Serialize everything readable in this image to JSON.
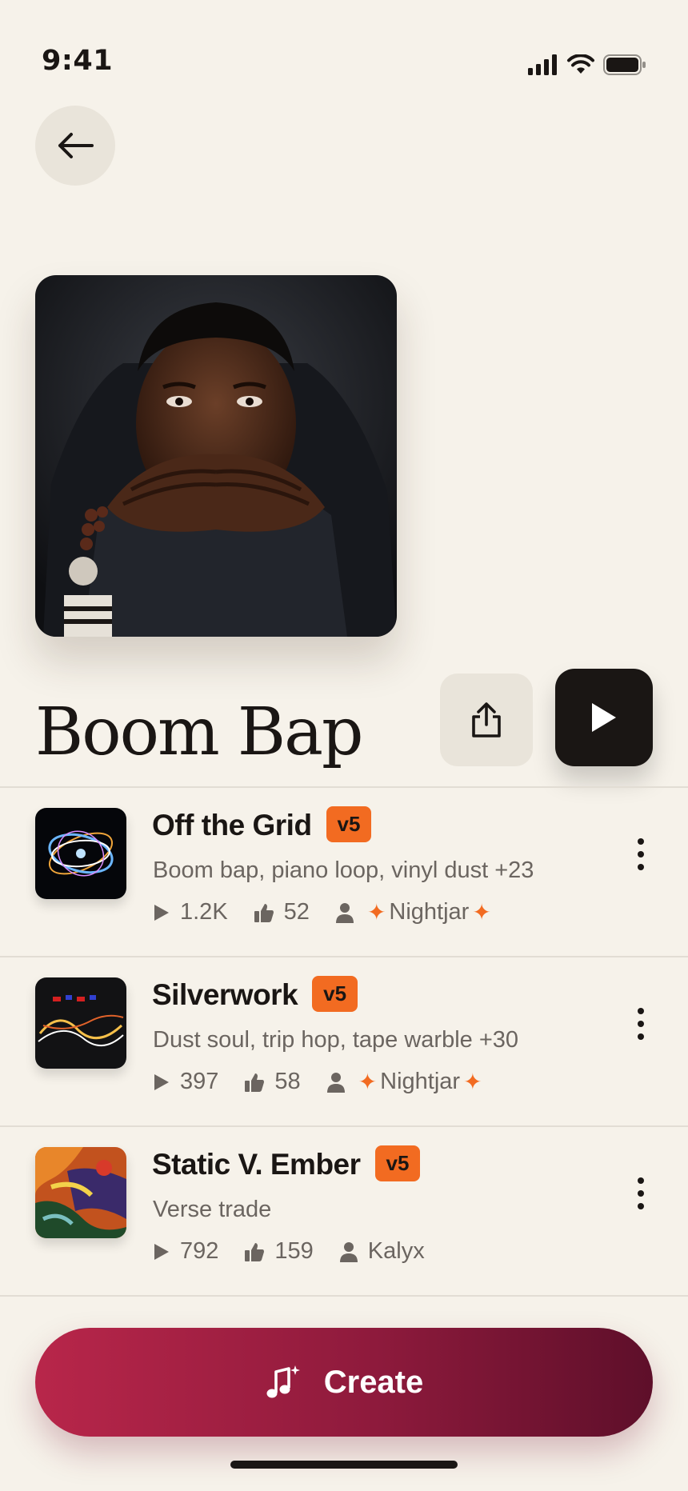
{
  "status_bar": {
    "time": "9:41"
  },
  "playlist": {
    "title": "Boom Bap"
  },
  "tracks": [
    {
      "title": "Off the Grid",
      "version": "v5",
      "tags": "Boom bap, piano loop, vinyl dust +23",
      "plays": "1.2K",
      "likes": "52",
      "author": "Nightjar",
      "author_featured": true
    },
    {
      "title": "Silverwork",
      "version": "v5",
      "tags": "Dust soul, trip hop, tape warble +30",
      "plays": "397",
      "likes": "58",
      "author": "Nightjar",
      "author_featured": true
    },
    {
      "title": "Static V. Ember",
      "version": "v5",
      "tags": "Verse trade",
      "plays": "792",
      "likes": "159",
      "author": "Kalyx",
      "author_featured": false
    }
  ],
  "create_button": {
    "label": "Create"
  },
  "colors": {
    "accent": "#f26b21",
    "create_start": "#b8264a",
    "create_end": "#5e0f2a",
    "background": "#f6f2ea"
  }
}
